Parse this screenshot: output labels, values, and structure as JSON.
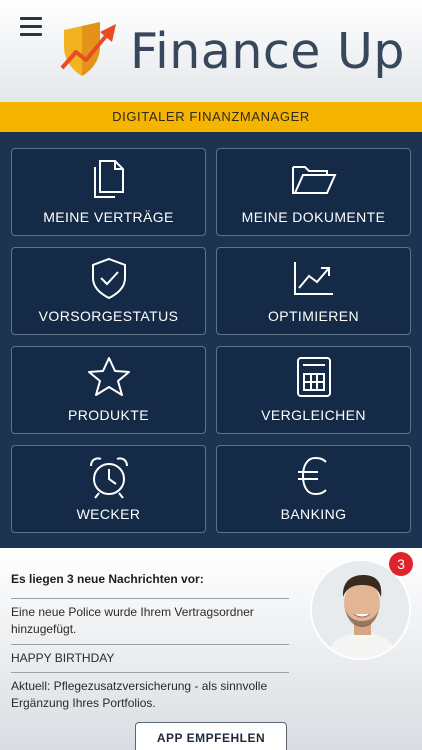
{
  "header": {
    "menu_icon": "hamburger-menu-icon",
    "logo_icon": "shield-chart-logo-icon",
    "app_name": "Finance Up"
  },
  "banner": {
    "text": "DIGITALER FINANZMANAGER"
  },
  "tiles": [
    {
      "label": "MEINE VERTRÄGE",
      "icon": "documents-copy-icon"
    },
    {
      "label": "MEINE DOKUMENTE",
      "icon": "folder-icon"
    },
    {
      "label": "VORSORGESTATUS",
      "icon": "shield-check-icon"
    },
    {
      "label": "OPTIMIEREN",
      "icon": "trending-up-chart-icon"
    },
    {
      "label": "PRODUKTE",
      "icon": "star-icon"
    },
    {
      "label": "VERGLEICHEN",
      "icon": "calculator-icon"
    },
    {
      "label": "WECKER",
      "icon": "alarm-clock-icon"
    },
    {
      "label": "BANKING",
      "icon": "euro-icon"
    }
  ],
  "news": {
    "title": "Es liegen 3 neue Nachrichten vor:",
    "items": [
      {
        "text": "Eine neue Police wurde Ihrem Vertragsordner hinzugefügt."
      },
      {
        "text": "HAPPY BIRTHDAY"
      },
      {
        "text": "Aktuell: Pflegezusatzversicherung - als sinnvolle Ergänzung Ihres Portfolios."
      }
    ],
    "badge_count": "3",
    "recommend_button": "APP EMPFEHLEN"
  },
  "colors": {
    "accent_yellow": "#f4b400",
    "tile_background": "#142a46",
    "page_background": "#1c3452",
    "badge_red": "#e2222a"
  }
}
